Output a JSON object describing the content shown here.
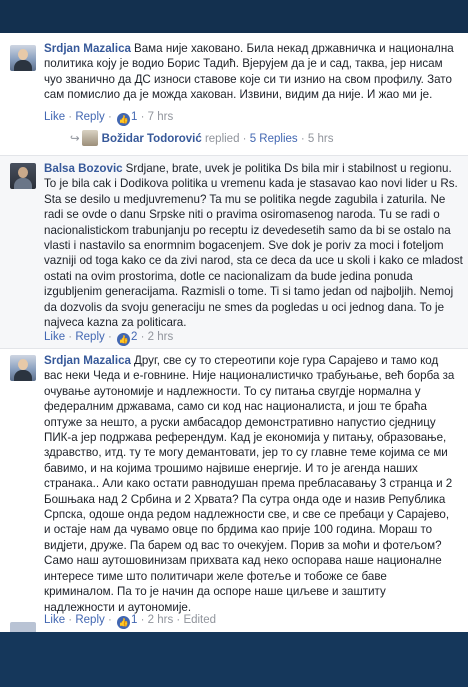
{
  "comments": [
    {
      "author": "Srdjan Mazalica",
      "lines": [
        "Вама није хаковано. Била некад државничка и национална",
        "политика коју је водио Борис Тадић. Вјерујем да је и сад, таква, јер нисам",
        "чуо званично да ДС износи ставове које си ти изнио на свом профилу. Зато",
        "сам помислио да је можда хакован. Извини, видим да није. И жао ми је."
      ],
      "actions": {
        "like": "Like",
        "reply": "Reply",
        "likes": "1",
        "time": "7 hrs"
      },
      "reply_preview": {
        "name": "Božidar Todorović",
        "verb": "replied",
        "count": "5 Replies",
        "time": "5 hrs"
      }
    },
    {
      "author": "Balsa Bozovic",
      "lines": [
        "Srdjane, brate, uvek je politika Ds bila mir i stabilnost u regionu.",
        "To je bila cak i Dodikova politika u vremenu kada je stasavao kao novi lider u Rs.",
        "Sta se desilo u medjuvremenu? Ta mu se politika negde zagubila i zaturila. Ne",
        "radi se ovde o danu Srpske niti o pravima osiromasenog naroda. Tu se radi o",
        "nacionalistickom trabunjanju po receptu iz devedesetih samo da bi se ostalo na",
        "vlasti i nastavilo sa enormnim bogacenjem. Sve dok je poriv za moci i foteljom",
        "vazniji od toga kako ce da zivi narod, sta ce deca da uce u skoli i kako ce mladost",
        "ostati na ovim prostorima, dotle ce nacionalizam da bude jedina ponuda",
        "izgubljenim generacijama. Razmisli o tome. Ti si tamo jedan od najboljih. Nemoj",
        "da dozvolis da svoju generaciju ne smes da pogledas u oci jednog dana. To je",
        "najveca kazna za politicara."
      ],
      "actions": {
        "like": "Like",
        "reply": "Reply",
        "likes": "2",
        "time": "2 hrs"
      }
    },
    {
      "author": "Srdjan Mazalica",
      "lines": [
        "Друг, све су то стереотипи које гура Сарајево и тамо код",
        "вас неки Чеда и е-говнине. Није националистичко трабуњање, већ борба за",
        "очување аутономије и надлежности. То су питања свугдје нормална у",
        "федералним државама, само си код нас националиста, и још те браћа",
        "оптуже за нешто, а руски амбасадор демонстративно напустио сједницу",
        "ПИК-а јер подржава референдум. Кад је економија у питању, образовање,",
        "здравство, итд. ту те могу демантовати, јер то су главне теме којима се ми",
        "бавимо, и на којима трошимо највише енергије. И то је агенда наших",
        "странака.. Али како остати равнодушан према пребласавању 3 странца и 2",
        "Бошњака над 2 Србина и 2 Хрвата? Па сутра онда оде и назив Република",
        "Српска, одоше онда редом надлежности све, и све се пребаци у Сарајево,",
        "и остаје нам да чувамо овце по брдима као прије 100 година. Мораш то",
        "видјети, друже. Па барем од вас то очекујем. Порив за моћи и фотељом?",
        "Само наш аутошовинизам прихвата кад неко оспорава наше националне",
        "интересе тиме што политичари желе фотеље и тобоже се баве",
        "криминалом. Па то је начин да оспоре наше циљеве и заштиту",
        "надлежности и аутономије."
      ],
      "actions": {
        "like": "Like",
        "reply": "Reply",
        "likes": "1",
        "time": "2 hrs",
        "edited": "Edited"
      }
    }
  ]
}
